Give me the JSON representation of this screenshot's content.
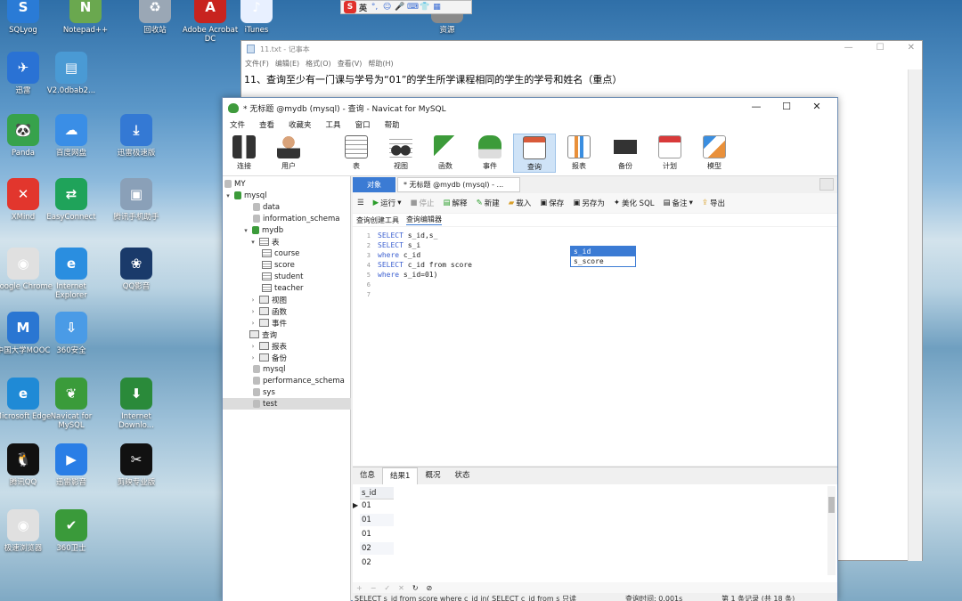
{
  "desktop": {
    "icons": [
      {
        "label": "SQLyog",
        "color": "#2a7bd6",
        "glyph": "S"
      },
      {
        "label": "Notepad++",
        "color": "#6aa84f",
        "glyph": "N"
      },
      {
        "label": "回收站",
        "color": "#9aa7b5",
        "glyph": "♻"
      },
      {
        "label": "Adobe Acrobat DC",
        "color": "#c8231f",
        "glyph": "A"
      },
      {
        "label": "iTunes",
        "color": "#e8f0ff",
        "glyph": "♪"
      },
      {
        "label": "资源",
        "color": "#8a8a8a",
        "glyph": "▦"
      },
      {
        "label": "迅雷",
        "color": "#2a72d4",
        "glyph": "✈"
      },
      {
        "label": "V2.0dbab2...",
        "color": "#4a9ad4",
        "glyph": "▤"
      },
      {
        "label": "Panda",
        "color": "#37a24c",
        "glyph": "🐼"
      },
      {
        "label": "百度网盘",
        "color": "#3a8ee6",
        "glyph": "☁"
      },
      {
        "label": "迅雷极速版",
        "color": "#3479d4",
        "glyph": "⤓"
      },
      {
        "label": "XMind",
        "color": "#e2362d",
        "glyph": "✕"
      },
      {
        "label": "EasyConnect",
        "color": "#1fa35a",
        "glyph": "⇄"
      },
      {
        "label": "腾讯手机助手",
        "color": "#8aa0b8",
        "glyph": "▣"
      },
      {
        "label": "Google Chrome",
        "color": "#e0e0e0",
        "glyph": "◉"
      },
      {
        "label": "Internet Explorer",
        "color": "#2a8ee0",
        "glyph": "e"
      },
      {
        "label": "QQ影音",
        "color": "#1a3a6a",
        "glyph": "❀"
      },
      {
        "label": "中国大学MOOC",
        "color": "#2a76d2",
        "glyph": "M"
      },
      {
        "label": "360安全",
        "color": "#4a9be6",
        "glyph": "⇩"
      },
      {
        "label": "Microsoft Edge",
        "color": "#1f8ad6",
        "glyph": "e"
      },
      {
        "label": "Navicat for MySQL",
        "color": "#3a9b3a",
        "glyph": "❦"
      },
      {
        "label": "Internet Downlo...",
        "color": "#2a8a3a",
        "glyph": "⬇"
      },
      {
        "label": "腾讯QQ",
        "color": "#111111",
        "glyph": "🐧"
      },
      {
        "label": "迅雷影音",
        "color": "#2a7ee6",
        "glyph": "▶"
      },
      {
        "label": "剪映专业版",
        "color": "#111111",
        "glyph": "✂"
      },
      {
        "label": "极速浏览器",
        "color": "#e0e0e0",
        "glyph": "◉"
      },
      {
        "label": "360卫士",
        "color": "#3a9a3a",
        "glyph": "✔"
      }
    ]
  },
  "ime": {
    "logo": "S",
    "mode": "英"
  },
  "notepad": {
    "title": "11.txt - 记事本",
    "menu": [
      "文件(F)",
      "编辑(E)",
      "格式(O)",
      "查看(V)",
      "帮助(H)"
    ],
    "text": "11、查询至少有一门课与学号为“01”的学生所学课程相同的学生的学号和姓名（重点）"
  },
  "navicat": {
    "title": "* 无标题 @mydb (mysql) - 查询 - Navicat for MySQL",
    "menu": [
      "文件",
      "查看",
      "收藏夹",
      "工具",
      "窗口",
      "帮助"
    ],
    "toolbar": [
      "连接",
      "用户",
      "表",
      "视图",
      "函数",
      "事件",
      "查询",
      "报表",
      "备份",
      "计划",
      "模型"
    ],
    "tree": {
      "items": [
        {
          "label": "MY"
        },
        {
          "label": "mysql"
        },
        {
          "label": "data"
        },
        {
          "label": "information_schema"
        },
        {
          "label": "mydb"
        },
        {
          "label": "表"
        },
        {
          "label": "course"
        },
        {
          "label": "score"
        },
        {
          "label": "student"
        },
        {
          "label": "teacher"
        },
        {
          "label": "视图"
        },
        {
          "label": "函数"
        },
        {
          "label": "事件"
        },
        {
          "label": "查询"
        },
        {
          "label": "报表"
        },
        {
          "label": "备份"
        },
        {
          "label": "mysql"
        },
        {
          "label": "performance_schema"
        },
        {
          "label": "sys"
        },
        {
          "label": "test"
        }
      ]
    },
    "tabs": {
      "objects": "对象",
      "query": "* 无标题 @mydb (mysql) - ..."
    },
    "query_toolbar": [
      "运行",
      "停止",
      "解释",
      "新建",
      "载入",
      "保存",
      "另存为",
      "美化 SQL",
      "备注",
      "导出"
    ],
    "sub_tabs": [
      "查询创建工具",
      "查询编辑器"
    ],
    "editor": {
      "line_numbers": [
        "1",
        "2",
        "3",
        "4",
        "5",
        "6",
        "7"
      ],
      "lines": [
        {
          "kw": "SELECT",
          "rest": " s_id,s_"
        },
        {
          "kw": "SELECT",
          "rest": " s_i"
        },
        {
          "kw": "where",
          "rest": " c_id"
        },
        {
          "kw": "SELECT",
          "rest": " c_id from score"
        },
        {
          "kw": "where",
          "rest": " s_id=01)"
        }
      ],
      "autocomplete": [
        "s_id",
        "s_score"
      ]
    },
    "result_tabs": [
      "信息",
      "结果1",
      "概况",
      "状态"
    ],
    "result": {
      "column": "s_id",
      "rows": [
        "01",
        "01",
        "01",
        "02",
        "02"
      ]
    },
    "status": {
      "sql": "SELECT s_id from score  where c_id in( SELECT c_id from s  只读",
      "time": "查询时间: 0.001s",
      "records": "第 1 条记录 (共 18 条)"
    }
  }
}
